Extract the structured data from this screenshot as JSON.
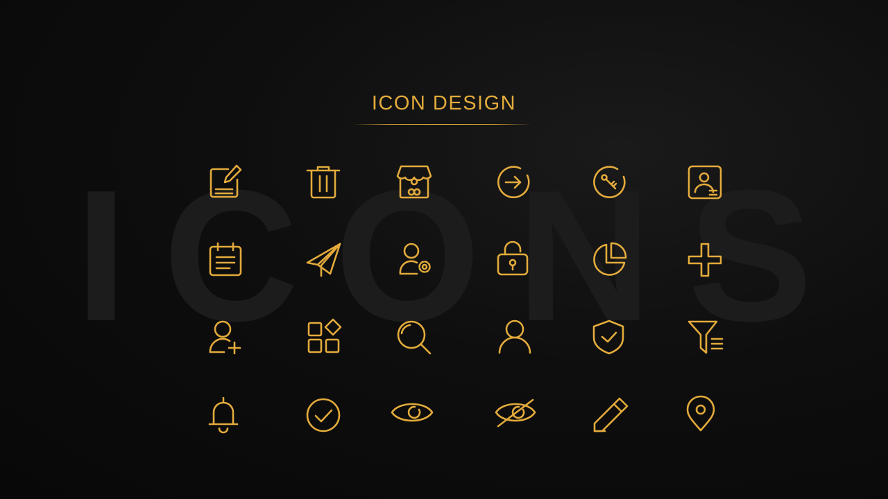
{
  "title": "ICON DESIGN",
  "watermark": "ICONS",
  "accent_color": "#e3ab3c",
  "background_color": "#0b0b0b",
  "icons": [
    [
      "edit-note-icon",
      "trash-icon",
      "store-icon",
      "arrow-right-circle-icon",
      "key-circle-icon",
      "contact-card-icon"
    ],
    [
      "calendar-icon",
      "send-paper-plane-icon",
      "user-settings-icon",
      "unlock-icon",
      "pie-chart-icon",
      "plus-icon"
    ],
    [
      "add-user-icon",
      "apps-grid-icon",
      "search-icon",
      "user-icon",
      "shield-check-icon",
      "filter-list-icon"
    ],
    [
      "bell-icon",
      "check-circle-icon",
      "eye-icon",
      "eye-off-icon",
      "pencil-icon",
      "location-pin-icon"
    ]
  ]
}
